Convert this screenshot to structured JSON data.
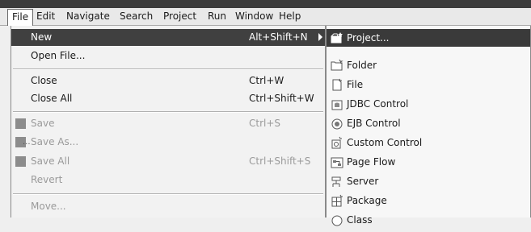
{
  "menubar": {
    "items": [
      {
        "label": "File"
      },
      {
        "label": "Edit"
      },
      {
        "label": "Navigate"
      },
      {
        "label": "Search"
      },
      {
        "label": "Project"
      },
      {
        "label": "Run"
      },
      {
        "label": "Window"
      },
      {
        "label": "Help"
      }
    ]
  },
  "file_menu": {
    "items": [
      {
        "label": "New",
        "shortcut": "Alt+Shift+N",
        "state": "highlighted",
        "has_submenu": true
      },
      {
        "label": "Open File...",
        "shortcut": ""
      },
      {
        "label": "Close",
        "shortcut": "Ctrl+W"
      },
      {
        "label": "Close All",
        "shortcut": "Ctrl+Shift+W"
      },
      {
        "label": "Save",
        "shortcut": "Ctrl+S",
        "state": "disabled"
      },
      {
        "label": "Save As...",
        "shortcut": "",
        "state": "disabled"
      },
      {
        "label": "Save All",
        "shortcut": "Ctrl+Shift+S",
        "state": "disabled"
      },
      {
        "label": "Revert",
        "shortcut": "",
        "state": "disabled"
      },
      {
        "label": "Move...",
        "shortcut": "",
        "state": "disabled"
      }
    ]
  },
  "new_submenu": {
    "items": [
      {
        "label": "Project...",
        "icon": "project-icon",
        "state": "highlighted"
      },
      {
        "label": "Folder",
        "icon": "folder-icon"
      },
      {
        "label": "File",
        "icon": "file-icon"
      },
      {
        "label": "JDBC Control",
        "icon": "jdbc-control-icon"
      },
      {
        "label": "EJB Control",
        "icon": "ejb-control-icon"
      },
      {
        "label": "Custom Control",
        "icon": "custom-control-icon"
      },
      {
        "label": "Page Flow",
        "icon": "page-flow-icon"
      },
      {
        "label": "Server",
        "icon": "server-icon"
      },
      {
        "label": "Package",
        "icon": "package-icon"
      },
      {
        "label": "Class",
        "icon": "class-icon"
      }
    ]
  },
  "colors": {
    "highlight": "#404040",
    "menu_bg": "#f2f2f2",
    "disabled_text": "#9a9a9a"
  }
}
